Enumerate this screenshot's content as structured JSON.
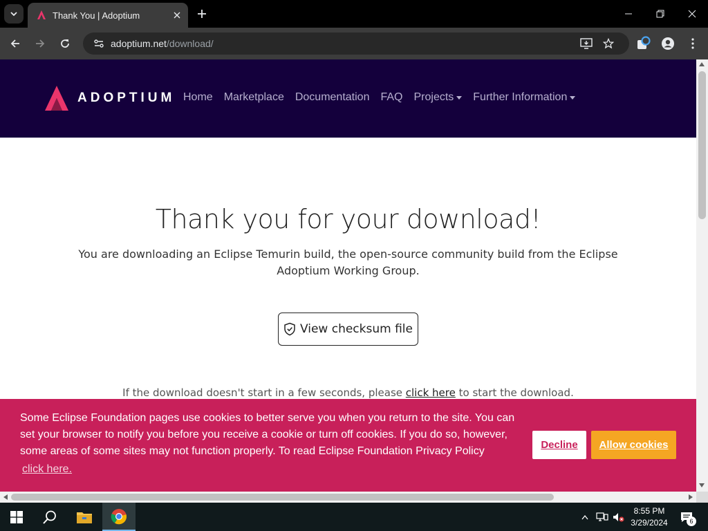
{
  "browser": {
    "tab_title": "Thank You | Adoptium",
    "url_host": "adoptium.net",
    "url_path": "/download/"
  },
  "site": {
    "logo_text": "ADOPTIUM",
    "nav": [
      {
        "label": "Home",
        "dropdown": false
      },
      {
        "label": "Marketplace",
        "dropdown": false
      },
      {
        "label": "Documentation",
        "dropdown": false
      },
      {
        "label": "FAQ",
        "dropdown": false
      },
      {
        "label": "Projects",
        "dropdown": true
      },
      {
        "label": "Further Information",
        "dropdown": true
      }
    ],
    "colors": {
      "nav_bg": "#14003c",
      "cookie_bg": "#c8205a",
      "allow_btn": "#f5a623",
      "brand": "#e9356b"
    }
  },
  "main": {
    "title": "Thank you for your download!",
    "subtitle": "You are downloading an Eclipse Temurin build, the open-source community build from the Eclipse Adoptium Working Group.",
    "checksum_button": "View checksum file",
    "note_before": "If the download doesn't start in a few seconds, please ",
    "note_link": "click here",
    "note_after": " to start the download."
  },
  "cookie_banner": {
    "message": "Some Eclipse Foundation pages use cookies to better serve you when you return to the site. You can set your browser to notify you before you receive a cookie or turn off cookies. If you do so, however, some areas of some sites may not function properly. To read Eclipse Foundation Privacy Policy",
    "link": "click here.",
    "decline": "Decline",
    "allow": "Allow cookies"
  },
  "taskbar": {
    "time": "8:55 PM",
    "date": "3/29/2024",
    "notification_count": "6"
  }
}
